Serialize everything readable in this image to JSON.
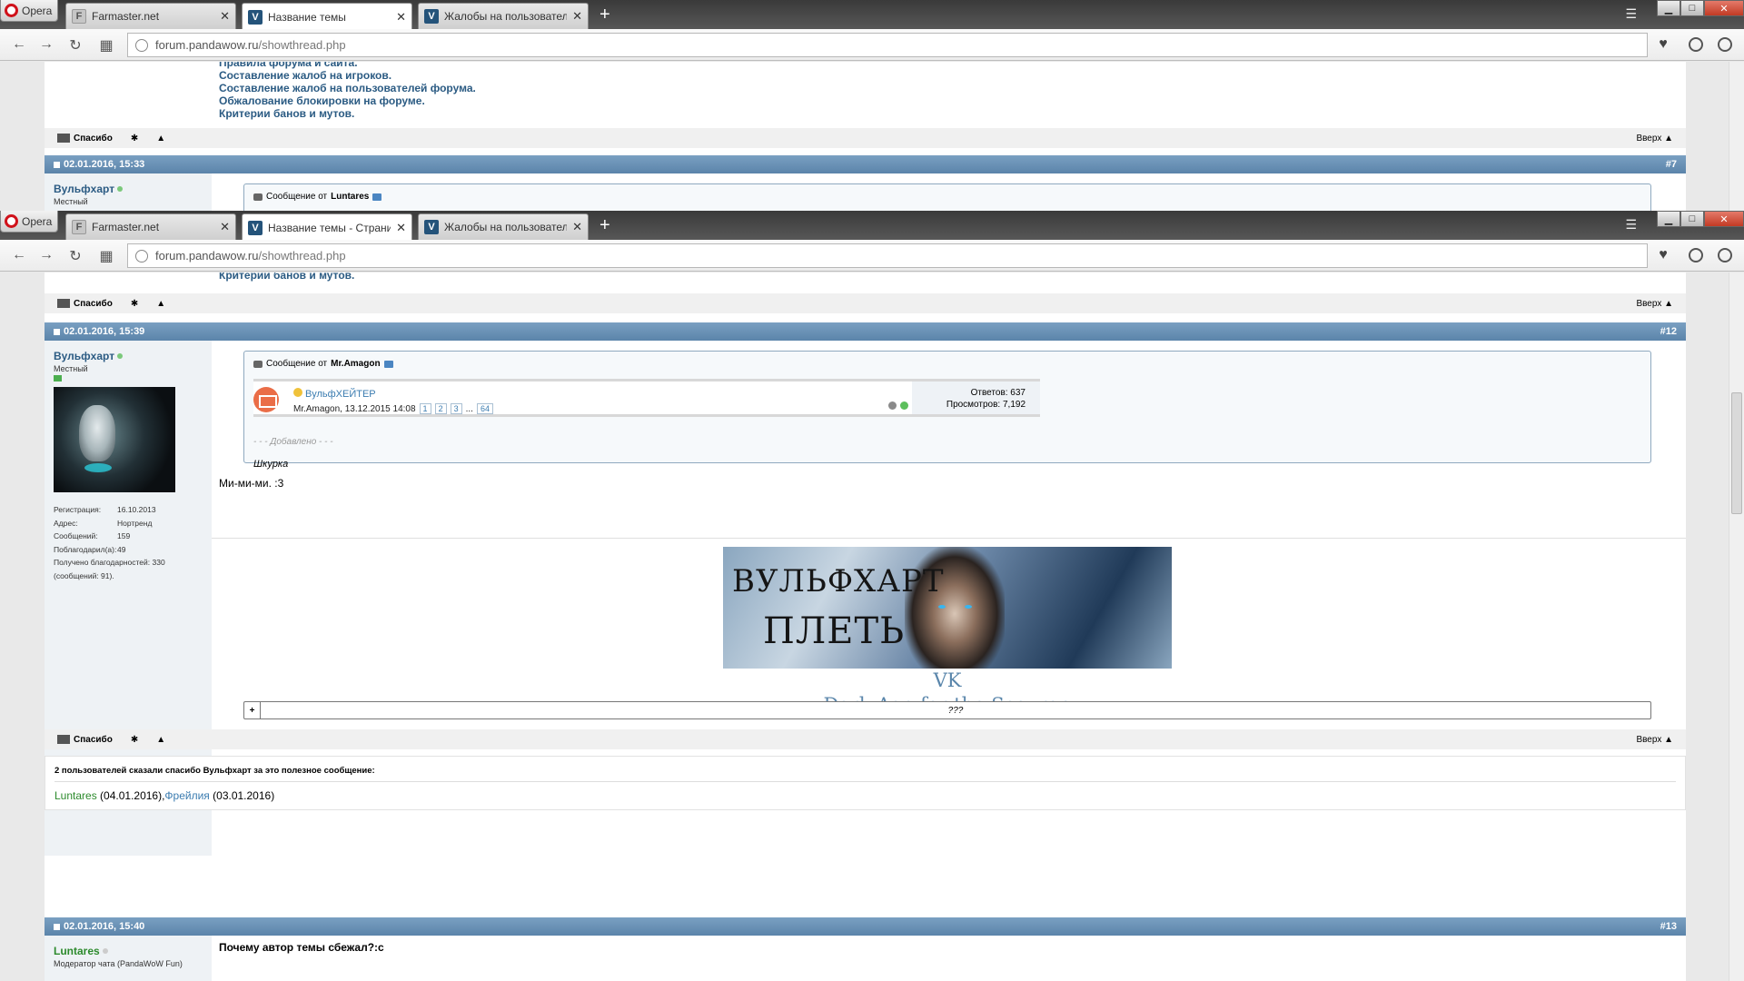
{
  "browser": {
    "opera_label": "Opera",
    "tabs_top": [
      {
        "title": "Farmaster.net",
        "fav": "F"
      },
      {
        "title": "Название темы",
        "fav": "V"
      },
      {
        "title": "Жалобы на пользовател",
        "fav": "V"
      }
    ],
    "tabs_bottom": [
      {
        "title": "Farmaster.net",
        "fav": "F"
      },
      {
        "title": "Название темы - Страни",
        "fav": "V"
      },
      {
        "title": "Жалобы на пользовател",
        "fav": "V"
      }
    ],
    "url_host": "forum.pandawow.ru",
    "url_path": "/showthread.php",
    "icons": [
      "back-icon",
      "forward-icon",
      "reload-icon",
      "speed-dial-icon",
      "globe-icon",
      "heart-icon",
      "download-icon",
      "account-icon"
    ]
  },
  "top_view": {
    "links": [
      "Правила форума и сайта.",
      "Составление жалоб на игроков.",
      "Составление жалоб на пользователей форума.",
      "Обжалование блокировки на форуме.",
      "Критерии банов и мутов."
    ],
    "footer": {
      "thanks": "Спасибо",
      "top": "Вверх ▲"
    },
    "post7": {
      "date": "02.01.2016, 15:33",
      "num": "#7",
      "user": "Вульфхарт",
      "rank": "Местный",
      "quote_prefix": "Сообщение от",
      "quote_author": "Luntares"
    }
  },
  "bottom_view": {
    "prev_link": "Критерии банов и мутов.",
    "footer": {
      "thanks": "Спасибо",
      "top": "Вверх ▲"
    },
    "post12": {
      "date": "02.01.2016, 15:39",
      "num": "#12",
      "user": "Вульфхарт",
      "rank": "Местный",
      "stats": [
        {
          "k": "Регистрация:",
          "v": "16.10.2013"
        },
        {
          "k": "Адрес:",
          "v": "Нортренд"
        },
        {
          "k": "Сообщений:",
          "v": "159"
        },
        {
          "k": "Поблагодарил(а):",
          "v": "49"
        }
      ],
      "stats_extra1": "Получено благодарностей: 330",
      "stats_extra2": "(сообщений: 91).",
      "quote_prefix": "Сообщение от",
      "quote_author": "Mr.Amagon",
      "thread_title": "ВульфХЕЙТЕР",
      "thread_meta": "Mr.Amagon, 13.12.2015 14:08",
      "pages": [
        "1",
        "2",
        "3",
        "...",
        "64"
      ],
      "replies": "Ответов: 637",
      "views": "Просмотров: 7,192",
      "added": "- - - Добавлено - - -",
      "quote_text": "Шкурка",
      "message": "Ми-ми-ми. :3",
      "banner_line1": "ВУЛЬФХАРТ",
      "banner_line2": "ПЛЕТЬ",
      "sig_vk": "VK",
      "sig_line2": "Dark Age for the Scourge",
      "spoiler_plus": "+",
      "spoiler_text": "???",
      "thanks_header": "2 пользователей сказали спасибо Вульфхарт за это полезное сообщение:",
      "thanks_users": [
        {
          "name": "Luntares",
          "date": " (04.01.2016),"
        },
        {
          "name": "Фрейлия",
          "date": " (03.01.2016)"
        }
      ]
    },
    "post13": {
      "date": "02.01.2016, 15:40",
      "num": "#13",
      "user": "Luntares",
      "rank": "Модератор чата (PandaWoW Fun)",
      "message": "Почему автор темы сбежал?:с"
    }
  },
  "colors": {
    "post_header": "#5b84aa",
    "link": "#2b5b83",
    "signature": "#5a86ab",
    "moderator_name": "#2c8a2c"
  }
}
